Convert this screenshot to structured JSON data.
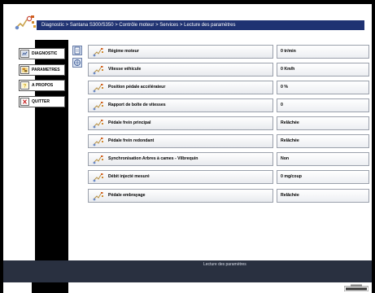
{
  "header": {
    "breadcrumb": "Diagnostic > Santana S300/S350 > Contrôle moteur > Services > Lecture des paramètres"
  },
  "menu": [
    {
      "label": "DIAGNOSTIC",
      "icon": "diagnostic-icon"
    },
    {
      "label": "PARAMETRES",
      "icon": "parameters-icon"
    },
    {
      "label": "A PROPOS",
      "icon": "question-icon"
    },
    {
      "label": "QUITTER",
      "icon": "close-icon"
    }
  ],
  "params": [
    {
      "label": "Régime moteur",
      "value": "0 tr/min"
    },
    {
      "label": "Vitesse véhicule",
      "value": "0 Km/h"
    },
    {
      "label": "Position pédale accélérateur",
      "value": "0 %"
    },
    {
      "label": "Rapport de boîte de vitesses",
      "value": "0"
    },
    {
      "label": "Pédale frein principal",
      "value": "Relâchée"
    },
    {
      "label": "Pédale frein redondant",
      "value": "Relâchée"
    },
    {
      "label": "Synchronisation Arbres à cames - Vilbrequin",
      "value": "Non"
    },
    {
      "label": "Débit injecté mesuré",
      "value": "0 mg/coup"
    },
    {
      "label": "Pédale embrayage",
      "value": "Relâchée"
    }
  ],
  "status": {
    "text": "Lecture des paramètres"
  },
  "colors": {
    "header_bar": "#1f3272",
    "footer": "#293040"
  }
}
